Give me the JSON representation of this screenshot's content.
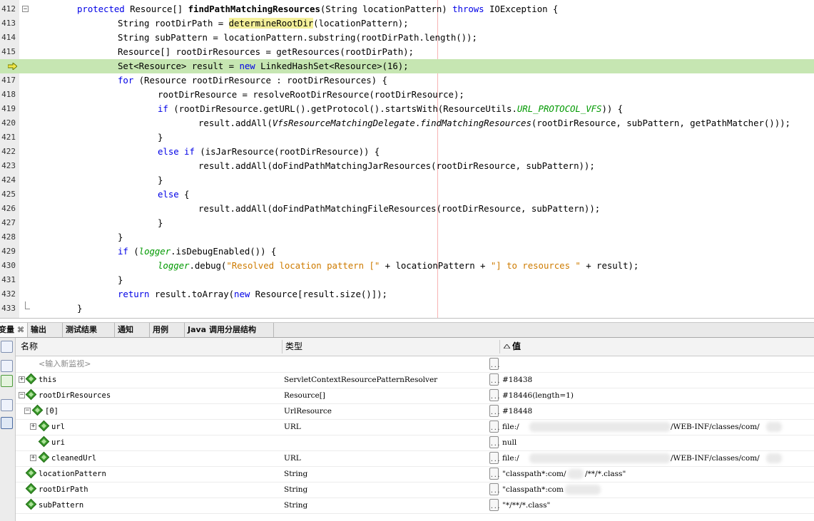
{
  "editor": {
    "lines": [
      {
        "n": "412"
      },
      {
        "n": "413"
      },
      {
        "n": "414"
      },
      {
        "n": "415"
      },
      {
        "n": "416"
      },
      {
        "n": "417"
      },
      {
        "n": "418"
      },
      {
        "n": "419"
      },
      {
        "n": "420"
      },
      {
        "n": "421"
      },
      {
        "n": "422"
      },
      {
        "n": "423"
      },
      {
        "n": "424"
      },
      {
        "n": "425"
      },
      {
        "n": "426"
      },
      {
        "n": "427"
      },
      {
        "n": "428"
      },
      {
        "n": "429"
      },
      {
        "n": "430"
      },
      {
        "n": "431"
      },
      {
        "n": "432"
      },
      {
        "n": "433"
      }
    ],
    "current_line_index": 4,
    "tokens": {
      "l412": [
        "protected",
        " Resource[] ",
        "findPathMatchingResources",
        "(String locationPattern) ",
        "throws",
        " IOException {"
      ],
      "l413": [
        "String rootDirPath = ",
        "determineRootDir",
        "(locationPattern);"
      ],
      "l414": [
        "String subPattern = locationPattern.substring(rootDirPath.length());"
      ],
      "l415": [
        "Resource[] rootDirResources = getResources(rootDirPath);"
      ],
      "l416": [
        "Set<Resource> result = ",
        "new",
        " LinkedHashSet<Resource>(16);"
      ],
      "l417": [
        "for",
        " (Resource rootDirResource : rootDirResources) {"
      ],
      "l418": [
        "rootDirResource = resolveRootDirResource(rootDirResource);"
      ],
      "l419": [
        "if",
        " (rootDirResource.getURL().getProtocol().startsWith(ResourceUtils.",
        "URL_PROTOCOL_VFS",
        ")) {"
      ],
      "l420": [
        "result.addAll(",
        "VfsResourceMatchingDelegate",
        ".",
        "findMatchingResources",
        "(rootDirResource, subPattern, getPathMatcher()));"
      ],
      "l421": [
        "}"
      ],
      "l422": [
        "else if",
        " (isJarResource(rootDirResource)) {"
      ],
      "l423": [
        "result.addAll(doFindPathMatchingJarResources(rootDirResource, subPattern));"
      ],
      "l424": [
        "}"
      ],
      "l425": [
        "else",
        " {"
      ],
      "l426": [
        "result.addAll(doFindPathMatchingFileResources(rootDirResource, subPattern));"
      ],
      "l427": [
        "}"
      ],
      "l428": [
        "}"
      ],
      "l429": [
        "if",
        " (",
        "logger",
        ".isDebugEnabled()) {"
      ],
      "l430": [
        "logger",
        ".debug(",
        "\"Resolved location pattern [\"",
        " + locationPattern + ",
        "\"] to resources \"",
        " + result);"
      ],
      "l431": [
        "}"
      ],
      "l432": [
        "return",
        " result.toArray(",
        "new",
        " Resource[result.size()]);"
      ],
      "l433": [
        "}"
      ]
    }
  },
  "tabs": [
    {
      "label": "变量",
      "close": "⌘"
    },
    {
      "label": "输出"
    },
    {
      "label": "测试结果"
    },
    {
      "label": "通知"
    },
    {
      "label": "用例"
    },
    {
      "label": "Java 调用分层结构"
    }
  ],
  "vars": {
    "headers": {
      "name": "名称",
      "type": "类型",
      "value": "值",
      "sort_icon": "sort-ascending-icon"
    },
    "watch_placeholder": "<输入新监视>",
    "rows": [
      {
        "name": "this",
        "type": "ServletContextResourcePatternResolver",
        "value": "#18438"
      },
      {
        "name": "rootDirResources",
        "type": "Resource[]",
        "value": "#18446(length=1)"
      },
      {
        "name": "[0]",
        "type": "UrlResource",
        "value": "#18448"
      },
      {
        "name": "url",
        "type": "URL",
        "value_a": "file:/",
        "value_b": "/WEB-INF/classes/com/"
      },
      {
        "name": "uri",
        "type": "",
        "value": "null"
      },
      {
        "name": "cleanedUrl",
        "type": "URL",
        "value_a": "file:/",
        "value_b": "/WEB-INF/classes/com/"
      },
      {
        "name": "locationPattern",
        "type": "String",
        "value_a": "\"classpath*:com/",
        "value_b": "/**/*.class\""
      },
      {
        "name": "rootDirPath",
        "type": "String",
        "value": "\"classpath*:com"
      },
      {
        "name": "subPattern",
        "type": "String",
        "value": "\"*/**/*.class\""
      }
    ]
  }
}
